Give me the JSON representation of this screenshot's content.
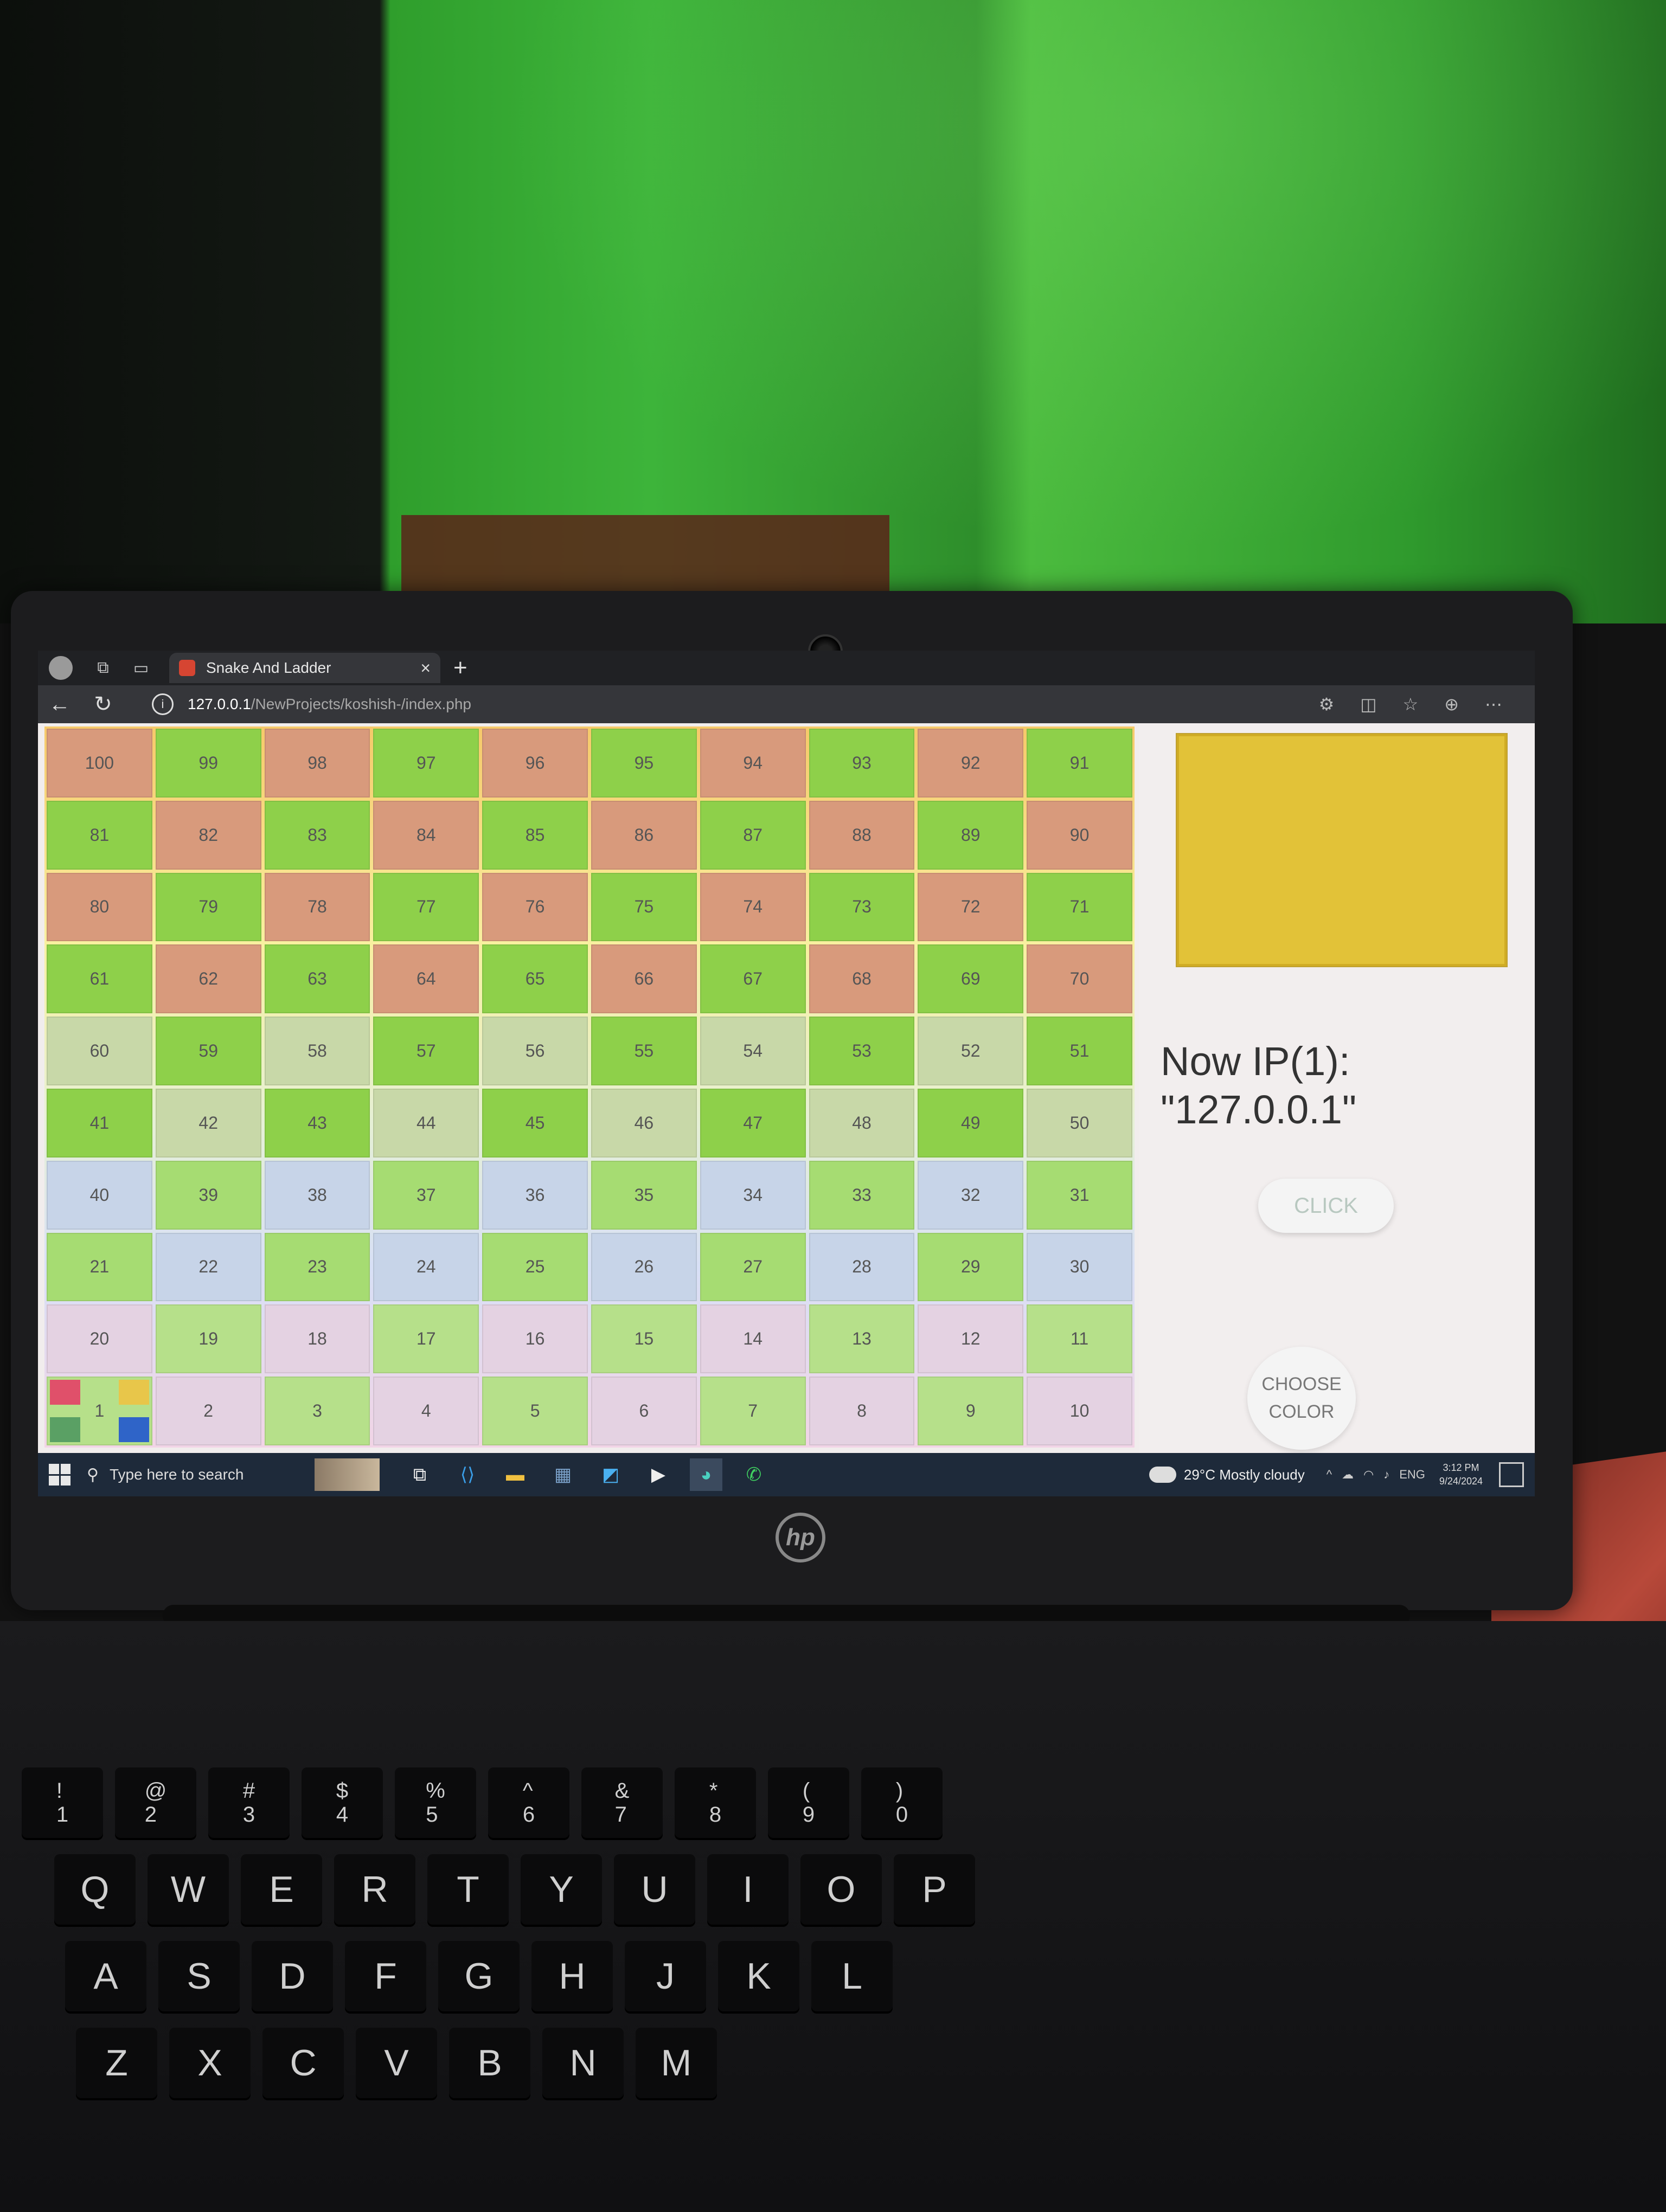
{
  "browser": {
    "tab_title": "Snake And Ladder",
    "tab_close": "×",
    "new_tab": "+",
    "url_host": "127.0.0.1",
    "url_path": "/NewProjects/koshish-/index.php"
  },
  "board": {
    "cells": [
      "100",
      "99",
      "98",
      "97",
      "96",
      "95",
      "94",
      "93",
      "92",
      "91",
      "81",
      "82",
      "83",
      "84",
      "85",
      "86",
      "87",
      "88",
      "89",
      "90",
      "80",
      "79",
      "78",
      "77",
      "76",
      "75",
      "74",
      "73",
      "72",
      "71",
      "61",
      "62",
      "63",
      "64",
      "65",
      "66",
      "67",
      "68",
      "69",
      "70",
      "60",
      "59",
      "58",
      "57",
      "56",
      "55",
      "54",
      "53",
      "52",
      "51",
      "41",
      "42",
      "43",
      "44",
      "45",
      "46",
      "47",
      "48",
      "49",
      "50",
      "40",
      "39",
      "38",
      "37",
      "36",
      "35",
      "34",
      "33",
      "32",
      "31",
      "21",
      "22",
      "23",
      "24",
      "25",
      "26",
      "27",
      "28",
      "29",
      "30",
      "20",
      "19",
      "18",
      "17",
      "16",
      "15",
      "14",
      "13",
      "12",
      "11",
      "1",
      "2",
      "3",
      "4",
      "5",
      "6",
      "7",
      "8",
      "9",
      "10"
    ],
    "player_colors": [
      "#e0506a",
      "#e8c64a",
      "#5aa064",
      "#2f64c8"
    ]
  },
  "side": {
    "dice_color": "#e2c238",
    "ip_label": "Now IP(1):",
    "ip_value": "\"127.0.0.1\"",
    "click_label": "CLICK",
    "choose_line1": "CHOOSE",
    "choose_line2": "COLOR"
  },
  "taskbar": {
    "search_placeholder": "Type here to search",
    "weather": "29°C  Mostly cloudy",
    "lang": "ENG",
    "time": "3:12 PM",
    "date": "9/24/2024"
  },
  "laptop": {
    "brand": "hp"
  },
  "keyboard": {
    "row1": [
      "!\n1",
      "@\n2",
      "#\n3",
      "$\n4",
      "%\n5",
      "^\n6",
      "&\n7",
      "*\n8",
      "(\n9",
      ")\n0"
    ],
    "row2": [
      "Q",
      "W",
      "E",
      "R",
      "T",
      "Y",
      "U",
      "I",
      "O",
      "P"
    ],
    "row3": [
      "A",
      "S",
      "D",
      "F",
      "G",
      "H",
      "J",
      "K",
      "L"
    ],
    "row4": [
      "Z",
      "X",
      "C",
      "V",
      "B",
      "N",
      "M"
    ]
  }
}
